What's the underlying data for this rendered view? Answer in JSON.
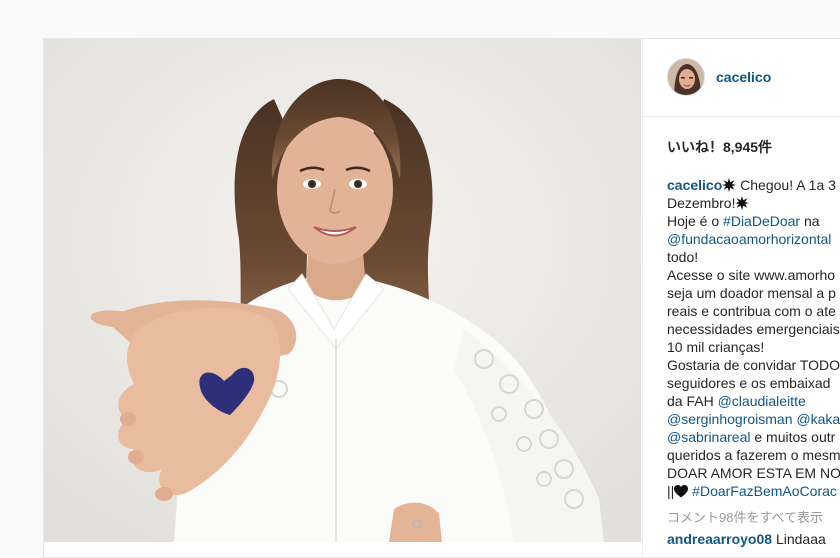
{
  "post": {
    "username": "cacelico",
    "likes_text": "いいね！8,945件",
    "caption_lines": [
      {
        "segments": [
          {
            "t": "user",
            "v": "cacelico"
          },
          {
            "t": "burst"
          },
          {
            "t": "text",
            "v": " Chegou! A 1a 3"
          }
        ]
      },
      {
        "segments": [
          {
            "t": "text",
            "v": "Dezembro!"
          },
          {
            "t": "burst"
          }
        ]
      },
      {
        "segments": [
          {
            "t": "text",
            "v": "Hoje é o "
          },
          {
            "t": "tag",
            "v": "#DiaDeDoar"
          },
          {
            "t": "text",
            "v": " na"
          }
        ]
      },
      {
        "segments": [
          {
            "t": "tag",
            "v": "@fundacaoamorhorizontal"
          }
        ]
      },
      {
        "segments": [
          {
            "t": "text",
            "v": "todo!"
          }
        ]
      },
      {
        "segments": [
          {
            "t": "text",
            "v": "Acesse o site www.amorho"
          }
        ]
      },
      {
        "segments": [
          {
            "t": "text",
            "v": "seja um doador mensal a p"
          }
        ]
      },
      {
        "segments": [
          {
            "t": "text",
            "v": "reais e contribua com o ate"
          }
        ]
      },
      {
        "segments": [
          {
            "t": "text",
            "v": "necessidades emergenciais"
          }
        ]
      },
      {
        "segments": [
          {
            "t": "text",
            "v": "10 mil crianças!"
          }
        ]
      },
      {
        "segments": [
          {
            "t": "text",
            "v": "Gostaria de convidar TODO"
          }
        ]
      },
      {
        "segments": [
          {
            "t": "text",
            "v": "seguidores e os embaixad"
          }
        ]
      },
      {
        "segments": [
          {
            "t": "text",
            "v": "da FAH "
          },
          {
            "t": "tag",
            "v": "@claudialeitte"
          }
        ]
      },
      {
        "segments": [
          {
            "t": "tag",
            "v": "@serginhogroisman"
          },
          {
            "t": "text",
            "v": " "
          },
          {
            "t": "tag",
            "v": "@kaka"
          }
        ]
      },
      {
        "segments": [
          {
            "t": "tag",
            "v": "@sabrinareal"
          },
          {
            "t": "text",
            "v": " e muitos outr"
          }
        ]
      },
      {
        "segments": [
          {
            "t": "text",
            "v": "queridos a fazerem o mesm"
          }
        ]
      },
      {
        "segments": [
          {
            "t": "text",
            "v": "DOAR AMOR ESTA EM NO"
          }
        ]
      },
      {
        "segments": [
          {
            "t": "text",
            "v": "||"
          },
          {
            "t": "heart"
          },
          {
            "t": "text",
            "v": " "
          },
          {
            "t": "tag",
            "v": "#DoarFazBemAoCorac"
          }
        ]
      }
    ],
    "more_comments": "コメント98件をすべて表示",
    "first_comment": {
      "user": "andreaarroyo08",
      "text": " Lindaaa"
    }
  },
  "colors": {
    "link": "#125688",
    "text": "#262626",
    "muted": "#999999",
    "border": "#efefef"
  }
}
